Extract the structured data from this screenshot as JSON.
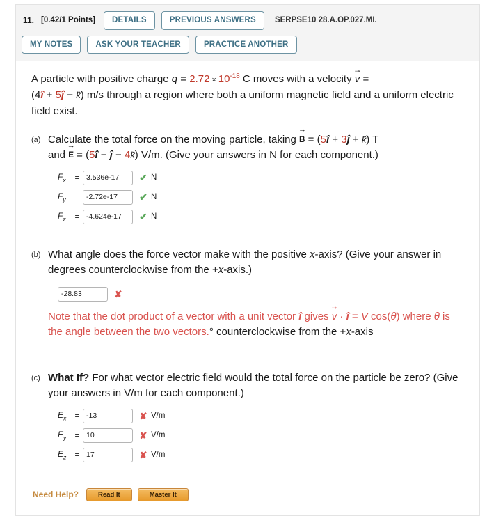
{
  "header": {
    "question_number": "11.",
    "points": "[0.42/1 Points]",
    "details_label": "DETAILS",
    "previous_answers_label": "PREVIOUS ANSWERS",
    "problem_code": "SERPSE10 28.A.OP.027.MI.",
    "my_notes_label": "MY NOTES",
    "ask_teacher_label": "ASK YOUR TEACHER",
    "practice_another_label": "PRACTICE ANOTHER"
  },
  "statement": {
    "t1": "A particle with positive charge ",
    "q_sym": "q",
    "eq1": " = ",
    "charge_value": "2.72",
    "times": "×",
    "base": "10",
    "exponent": "-18",
    "t2": " C moves with a velocity ",
    "v_sym": "v",
    "eq2": " =",
    "t3": "(4",
    "i_hat": "î",
    "plus": " + ",
    "five": "5",
    "j_hat": "ĵ",
    "minus": " − ",
    "k_hat": "k̂",
    "t4": ") m/s through a region where both a uniform magnetic field and a uniform electric field exist."
  },
  "part_a": {
    "label": "(a)",
    "text_1": "Calculate the total force on the moving particle, taking ",
    "b_sym": "B",
    "b_eq": " = (",
    "b_i_coef": "5",
    "b_plus1": " + ",
    "b_j_coef": "3",
    "b_plus2": " + ",
    "b_close": ") T",
    "text_2": "and ",
    "e_sym": "E",
    "e_eq": " = (",
    "e_i_coef": "5",
    "e_minus1": " − ",
    "e_minus2": " − ",
    "e_k_coef": "4",
    "e_close": ") V/m. (Give your answers in N for each component.)",
    "answers": [
      {
        "symbol": "F",
        "sub": "x",
        "eq": "=",
        "value": "3.536e-17",
        "mark": "✔",
        "mark_state": "correct",
        "unit": "N"
      },
      {
        "symbol": "F",
        "sub": "y",
        "eq": "=",
        "value": "-2.72e-17",
        "mark": "✔",
        "mark_state": "correct",
        "unit": "N"
      },
      {
        "symbol": "F",
        "sub": "z",
        "eq": "=",
        "value": "-4.624e-17",
        "mark": "✔",
        "mark_state": "correct",
        "unit": "N"
      }
    ]
  },
  "part_b": {
    "label": "(b)",
    "text_1": "What angle does the force vector make with the positive ",
    "x_sym": "x",
    "text_2": "-axis? (Give your answer in degrees counterclockwise from the +",
    "x_sym2": "x",
    "text_3": "-axis.)",
    "answer_value": "-28.83",
    "mark": "✘",
    "mark_state": "incorrect",
    "feedback_note_1": "Note that the dot product of a vector with a unit vector ",
    "feedback_i_hat": "î",
    "feedback_note_2": " gives ",
    "feedback_v": "v",
    "feedback_dot": " · ",
    "feedback_eq": " = ",
    "feedback_V": "V",
    "feedback_note_3": "cos(",
    "feedback_theta": "θ",
    "feedback_note_4": ") where ",
    "feedback_theta2": "θ",
    "feedback_note_5": " is the angle between the two vectors.",
    "feedback_tail_1": "° counterclockwise from the +",
    "feedback_tail_x": "x",
    "feedback_tail_2": "-axis"
  },
  "part_c": {
    "label": "(c)",
    "what_if": "What If?",
    "text": " For what vector electric field would the total force on the particle be zero? (Give your answers in V/m for each component.)",
    "answers": [
      {
        "symbol": "E",
        "sub": "x",
        "eq": "=",
        "value": "-13",
        "mark": "✘",
        "mark_state": "incorrect",
        "unit": "V/m"
      },
      {
        "symbol": "E",
        "sub": "y",
        "eq": "=",
        "value": "10",
        "mark": "✘",
        "mark_state": "incorrect",
        "unit": "V/m"
      },
      {
        "symbol": "E",
        "sub": "z",
        "eq": "=",
        "value": "17",
        "mark": "✘",
        "mark_state": "incorrect",
        "unit": "V/m"
      }
    ]
  },
  "need_help": {
    "label": "Need Help?",
    "read_it_label": "Read It",
    "master_it_label": "Master It"
  },
  "colors": {
    "pill_border": "#6d93a3",
    "pill_text": "#3d6f84",
    "red_value": "#c0392b",
    "feedback_red": "#d9534f",
    "correct_green": "#5ba85b",
    "incorrect_red": "#d9534f",
    "help_orange": "#e79a2c",
    "need_help_label": "#c58a3f"
  }
}
